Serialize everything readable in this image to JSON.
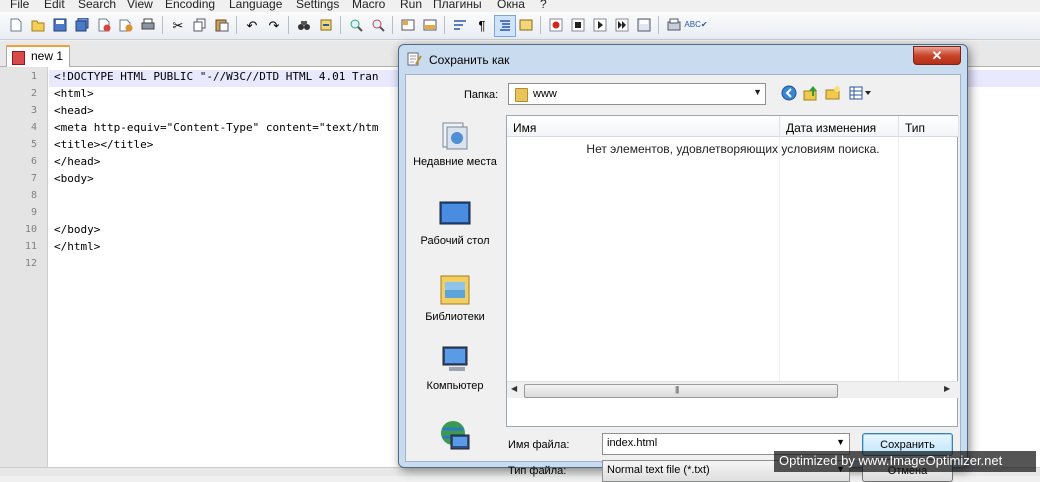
{
  "menu": [
    "File",
    "Edit",
    "Search",
    "View",
    "Encoding",
    "Language",
    "Settings",
    "Macro",
    "Run",
    "Плагины",
    "Окна",
    "?"
  ],
  "tab": {
    "label": "new  1"
  },
  "editor": {
    "line_numbers": [
      "1",
      "2",
      "3",
      "4",
      "5",
      "6",
      "7",
      "8",
      "9",
      "10",
      "11",
      "12"
    ],
    "lines": [
      "<!DOCTYPE HTML PUBLIC \"-//W3C//DTD HTML 4.01 Tran",
      "<html>",
      "<head>",
      "<meta http-equiv=\"Content-Type\" content=\"text/htm",
      "<title></title>",
      "</head>",
      "<body>",
      "",
      "",
      "</body>",
      "</html>",
      ""
    ]
  },
  "dialog": {
    "title": "Сохранить как",
    "close_glyph": "✕",
    "lookin_label": "Папка:",
    "lookin_value": "www",
    "places": [
      {
        "label": "Недавние места",
        "icon": "recent-places-icon"
      },
      {
        "label": "Рабочий стол",
        "icon": "desktop-icon"
      },
      {
        "label": "Библиотеки",
        "icon": "libraries-icon"
      },
      {
        "label": "Компьютер",
        "icon": "computer-icon"
      },
      {
        "label": "",
        "icon": "network-icon"
      }
    ],
    "columns": [
      "Имя",
      "Дата изменения",
      "Тип"
    ],
    "empty_message": "Нет элементов, удовлетворяющих условиям поиска.",
    "filename_label": "Имя файла:",
    "filename_value": "index.html",
    "filetype_label": "Тип файла:",
    "filetype_value": "Normal text file (*.txt)",
    "save_button": "Сохранить",
    "cancel_button": "Отмена"
  },
  "watermark": "Optimized by www.ImageOptimizer.net",
  "colors": {
    "title_close": "#c9442c",
    "tab_accent": "#f5a03c",
    "current_line": "#e8e8ff"
  }
}
